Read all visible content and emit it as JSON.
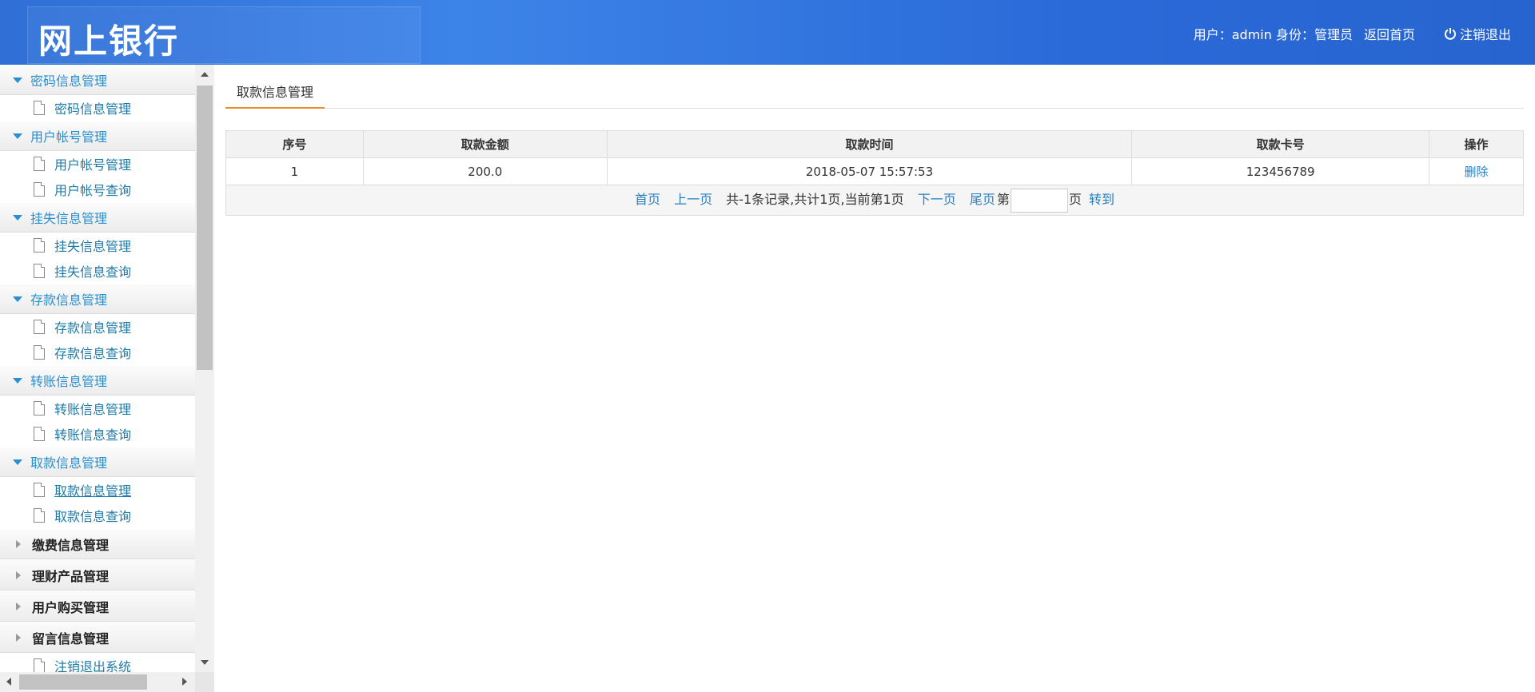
{
  "header": {
    "logo": "网上银行",
    "user_text": "用户：admin 身份：管理员",
    "home_label": "返回首页",
    "logout_label": "注销退出"
  },
  "sidebar": {
    "groups": [
      {
        "title": "密码信息管理",
        "items": [
          "密码信息管理"
        ]
      },
      {
        "title": "用户帐号管理",
        "items": [
          "用户帐号管理",
          "用户帐号查询"
        ]
      },
      {
        "title": "挂失信息管理",
        "items": [
          "挂失信息管理",
          "挂失信息查询"
        ]
      },
      {
        "title": "存款信息管理",
        "items": [
          "存款信息管理",
          "存款信息查询"
        ]
      },
      {
        "title": "转账信息管理",
        "items": [
          "转账信息管理",
          "转账信息查询"
        ]
      },
      {
        "title": "取款信息管理",
        "items": [
          "取款信息管理",
          "取款信息查询"
        ]
      }
    ],
    "closed_groups": [
      "缴费信息管理",
      "理财产品管理",
      "用户购买管理",
      "留言信息管理"
    ],
    "partial_item": "注销退出系统"
  },
  "main": {
    "tab_label": "取款信息管理",
    "columns": [
      "序号",
      "取款金额",
      "取款时间",
      "取款卡号",
      "操作"
    ],
    "rows": [
      {
        "index": "1",
        "amount": "200.0",
        "time": "2018-05-07 15:57:53",
        "card": "123456789",
        "action": "删除"
      }
    ],
    "pager": {
      "first": "首页",
      "prev": "上一页",
      "summary": "共-1条记录,共计1页,当前第1页",
      "next": "下一页",
      "last": "尾页",
      "page_prefix": "第",
      "page_suffix": "页",
      "go": "转到",
      "page_input_value": ""
    }
  }
}
